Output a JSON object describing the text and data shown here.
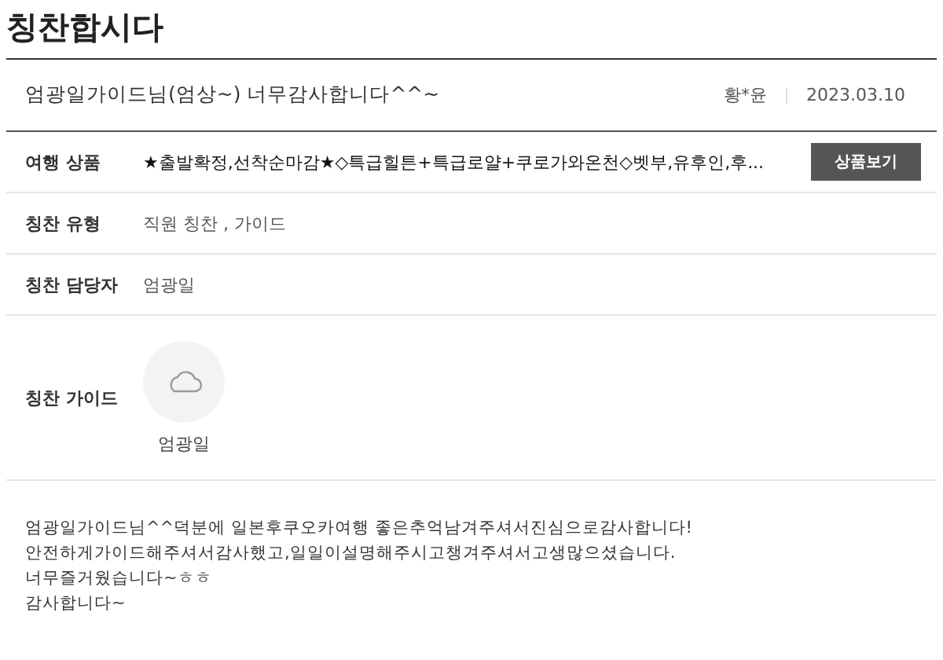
{
  "page_title": "칭찬합시다",
  "post": {
    "title": "엄광일가이드님(엄상~) 너무감사합니다^^~",
    "author": "황*윤",
    "date": "2023.03.10"
  },
  "fields": [
    {
      "kind": "product",
      "label": "여행 상품",
      "value": "★출발확정,선착순마감★◇특급힐튼+특급로얄+쿠로가와온천◇벳부,유후인,후...",
      "button": "상품보기"
    },
    {
      "kind": "text",
      "label": "칭찬 유형",
      "value": "직원 칭찬 , 가이드"
    },
    {
      "kind": "text",
      "label": "칭찬 담당자",
      "value": "엄광일"
    },
    {
      "kind": "guide",
      "label": "칭찬 가이드",
      "value": "엄광일"
    }
  ],
  "body": [
    "엄광일가이드님^^덕분에 일본후쿠오카여행 좋은추억남겨주셔서진심으로감사합니다!",
    "안전하게가이드해주셔서감사했고,일일이설명해주시고챙겨주셔서고생많으셨습니다.",
    "너무즐거웠습니다~ㅎㅎ",
    "감사합니다~"
  ]
}
